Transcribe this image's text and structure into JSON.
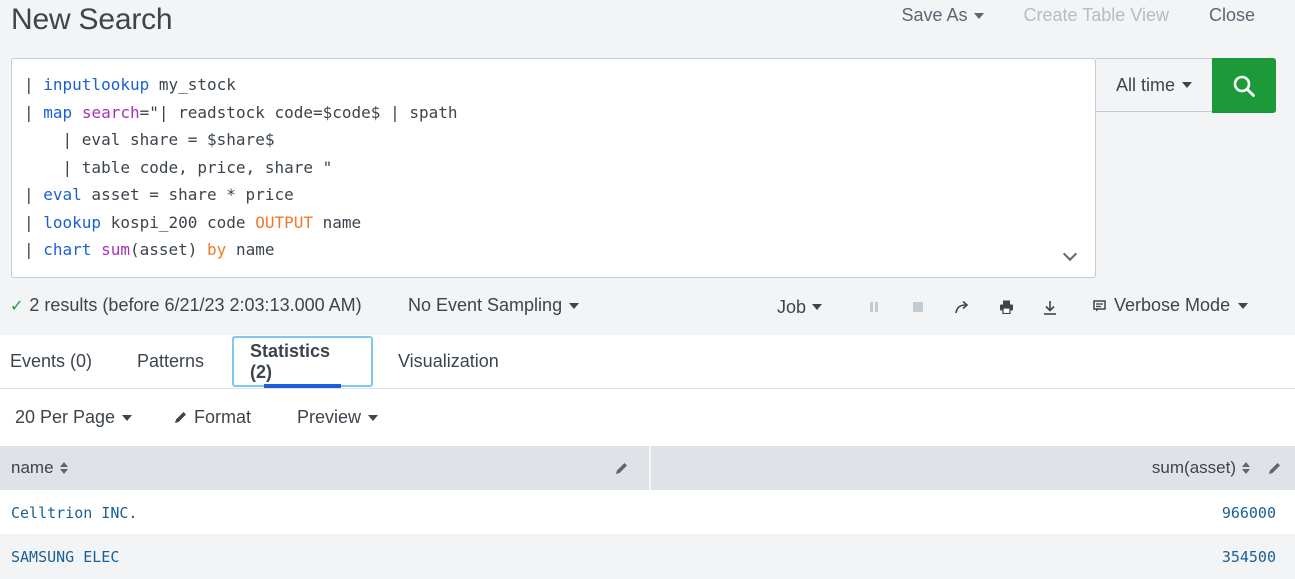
{
  "header": {
    "title": "New Search",
    "save_as": "Save As",
    "create_table_view": "Create Table View",
    "close": "Close"
  },
  "query": {
    "lines": [
      [
        {
          "t": "| ",
          "c": ""
        },
        {
          "t": "inputlookup",
          "c": "kw"
        },
        {
          "t": " my_stock",
          "c": ""
        }
      ],
      [
        {
          "t": "| ",
          "c": ""
        },
        {
          "t": "map",
          "c": "kw"
        },
        {
          "t": " ",
          "c": ""
        },
        {
          "t": "search",
          "c": "fn"
        },
        {
          "t": "=\"| readstock code=$code$ | spath",
          "c": ""
        }
      ],
      [
        {
          "t": "    | eval share = $share$",
          "c": ""
        }
      ],
      [
        {
          "t": "    | table code, price, share \"",
          "c": ""
        }
      ],
      [
        {
          "t": "| ",
          "c": ""
        },
        {
          "t": "eval",
          "c": "kw"
        },
        {
          "t": " asset = share * price",
          "c": ""
        }
      ],
      [
        {
          "t": "| ",
          "c": ""
        },
        {
          "t": "lookup",
          "c": "kw"
        },
        {
          "t": " kospi_200 code ",
          "c": ""
        },
        {
          "t": "OUTPUT",
          "c": "op"
        },
        {
          "t": " name",
          "c": ""
        }
      ],
      [
        {
          "t": "| ",
          "c": ""
        },
        {
          "t": "chart",
          "c": "kw"
        },
        {
          "t": " ",
          "c": ""
        },
        {
          "t": "sum",
          "c": "fn"
        },
        {
          "t": "(asset) ",
          "c": ""
        },
        {
          "t": "by",
          "c": "op"
        },
        {
          "t": " name",
          "c": ""
        }
      ]
    ],
    "expand_icon": "chevron-down-icon"
  },
  "time_range": {
    "label": "All time"
  },
  "search_button": {
    "icon": "search-icon",
    "color": "#1c9a3a"
  },
  "status": {
    "results": "2 results (before 6/21/23 2:03:13.000 AM)",
    "sampling": "No Event Sampling",
    "job": "Job",
    "mode": "Verbose Mode"
  },
  "tabs": [
    {
      "label": "Events (0)"
    },
    {
      "label": "Patterns"
    },
    {
      "label": "Statistics (2)",
      "active": true
    },
    {
      "label": "Visualization"
    }
  ],
  "toolbar": {
    "per_page": "20 Per Page",
    "format": "Format",
    "preview": "Preview"
  },
  "table": {
    "columns": [
      "name",
      "sum(asset)"
    ],
    "rows": [
      {
        "name": "Celltrion INC.",
        "value": "966000"
      },
      {
        "name": "SAMSUNG ELEC",
        "value": "354500"
      }
    ]
  },
  "colors": {
    "accent": "#1a5fd8",
    "link": "#1a5f96",
    "success": "#1c9a3a"
  }
}
